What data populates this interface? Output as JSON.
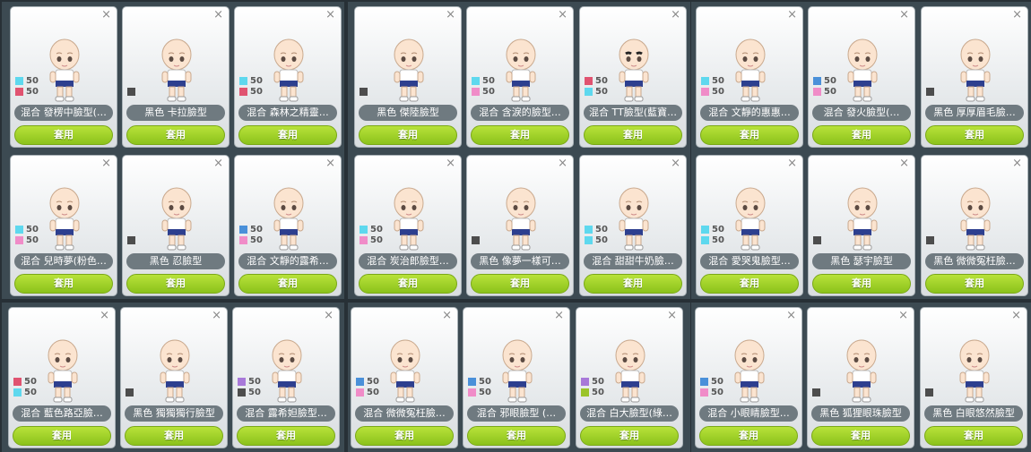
{
  "apply_label": "套用",
  "close_glyph": "×",
  "colors": {
    "cyan": "#5ed8ee",
    "pink": "#f08cc8",
    "red": "#e05370",
    "blue": "#4a90d9",
    "purple": "#a879d9",
    "green": "#9bc42a",
    "dark": "#4d4d4d"
  },
  "cards": [
    {
      "name": "混合 發楞中臉型(…",
      "swatches": [
        {
          "color": "cyan",
          "value": "50"
        },
        {
          "color": "red",
          "value": "50"
        }
      ]
    },
    {
      "name": "黑色 卡拉臉型",
      "swatches": []
    },
    {
      "name": "混合 森林之精靈…",
      "swatches": [
        {
          "color": "cyan",
          "value": "50"
        },
        {
          "color": "red",
          "value": "50"
        }
      ]
    },
    {
      "name": "黑色 傑陸臉型",
      "swatches": []
    },
    {
      "name": "混合 含淚的臉型…",
      "swatches": [
        {
          "color": "cyan",
          "value": "50"
        },
        {
          "color": "pink",
          "value": "50"
        }
      ]
    },
    {
      "name": "混合 TT臉型(藍寶…",
      "swatches": [
        {
          "color": "red",
          "value": "50"
        },
        {
          "color": "cyan",
          "value": "50"
        }
      ]
    },
    {
      "name": "混合 文靜的惠惠…",
      "swatches": [
        {
          "color": "cyan",
          "value": "50"
        },
        {
          "color": "pink",
          "value": "50"
        }
      ]
    },
    {
      "name": "混合 發火臉型(…",
      "swatches": [
        {
          "color": "blue",
          "value": "50"
        },
        {
          "color": "pink",
          "value": "50"
        }
      ]
    },
    {
      "name": "黑色 厚厚眉毛臉…",
      "swatches": []
    },
    {
      "name": "混合 兒時夢(粉色…",
      "swatches": [
        {
          "color": "cyan",
          "value": "50"
        },
        {
          "color": "pink",
          "value": "50"
        }
      ]
    },
    {
      "name": "黑色 忍臉型",
      "swatches": []
    },
    {
      "name": "混合 文靜的露希…",
      "swatches": [
        {
          "color": "blue",
          "value": "50"
        },
        {
          "color": "pink",
          "value": "50"
        }
      ]
    },
    {
      "name": "混合 炭治郎臉型…",
      "swatches": [
        {
          "color": "cyan",
          "value": "50"
        },
        {
          "color": "pink",
          "value": "50"
        }
      ]
    },
    {
      "name": "黑色 像夢一樣可…",
      "swatches": []
    },
    {
      "name": "混合 甜甜牛奶臉…",
      "swatches": [
        {
          "color": "cyan",
          "value": "50"
        },
        {
          "color": "cyan",
          "value": "50"
        }
      ]
    },
    {
      "name": "混合 愛哭鬼臉型…",
      "swatches": [
        {
          "color": "cyan",
          "value": "50"
        },
        {
          "color": "cyan",
          "value": "50"
        }
      ]
    },
    {
      "name": "黑色 瑟宇臉型",
      "swatches": []
    },
    {
      "name": "黑色 微微冤枉臉…",
      "swatches": []
    },
    {
      "name": "混合 藍色路亞臉…",
      "swatches": [
        {
          "color": "red",
          "value": "50"
        },
        {
          "color": "cyan",
          "value": "50"
        }
      ]
    },
    {
      "name": "黑色 獨獨獨行臉型",
      "swatches": []
    },
    {
      "name": "混合 露希妲臉型…",
      "swatches": [
        {
          "color": "purple",
          "value": "50"
        },
        {
          "color": "dark",
          "value": "50"
        }
      ]
    },
    {
      "name": "混合 微微冤枉臉…",
      "swatches": [
        {
          "color": "blue",
          "value": "50"
        },
        {
          "color": "pink",
          "value": "50"
        }
      ]
    },
    {
      "name": "混合 邪眼臉型 (…",
      "swatches": [
        {
          "color": "blue",
          "value": "50"
        },
        {
          "color": "pink",
          "value": "50"
        }
      ]
    },
    {
      "name": "混合 白大臉型(綠…",
      "swatches": [
        {
          "color": "purple",
          "value": "50"
        },
        {
          "color": "green",
          "value": "50"
        }
      ]
    },
    {
      "name": "混合 小眼睛臉型…",
      "swatches": [
        {
          "color": "blue",
          "value": "50"
        },
        {
          "color": "pink",
          "value": "50"
        }
      ]
    },
    {
      "name": "黑色 狐狸眼珠臉型",
      "swatches": []
    },
    {
      "name": "黑色 白眼悠然臉型",
      "swatches": []
    }
  ]
}
